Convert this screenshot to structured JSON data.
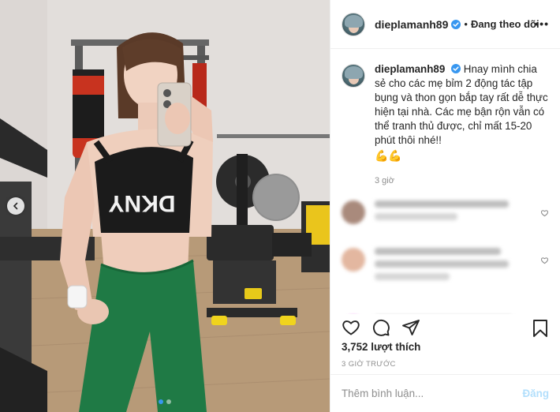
{
  "post": {
    "username": "dieplamanh89",
    "follow_separator": "•",
    "follow_label": "Đang theo dõi",
    "more_label": "•••",
    "caption": "Hnay mình chia sẻ cho các mẹ bỉm 2 động tác tập bụng và thon gọn bắp tay rất dễ thực hiện tại nhà. Các mẹ bận rộn vẫn có thể tranh thủ được, chỉ mất 15-20 phút thôi nhé!!",
    "caption_emoji": "💪💪",
    "caption_time": "3 giờ",
    "likes": "3,752 lượt thích",
    "timestamp": "3 GIỜ TRƯỚC",
    "comment_placeholder": "Thêm bình luận...",
    "post_label": "Đăng"
  },
  "photo": {
    "text_on_top": "DKNY",
    "carousel_count": 2,
    "active_index": 0
  },
  "colors": {
    "verified": "#3897f0",
    "post_disabled": "#b2dffc",
    "leggings": "#1f7a45",
    "top": "#1b1b1b"
  },
  "icons": [
    "verified-badge-icon",
    "more-options-icon",
    "heart-icon",
    "comment-icon",
    "share-icon",
    "bookmark-icon",
    "chevron-left-icon"
  ]
}
